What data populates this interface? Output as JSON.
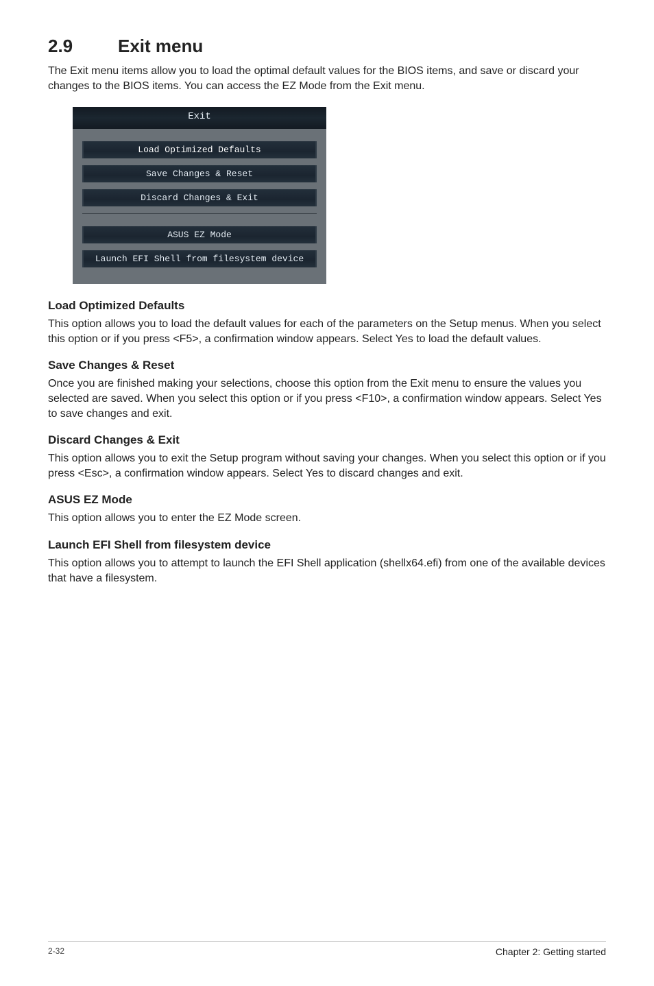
{
  "section": {
    "number": "2.9",
    "title": "Exit menu"
  },
  "intro": "The Exit menu items allow you to load the optimal default values for the BIOS items, and save or discard your changes to the BIOS items. You can access the EZ Mode from the Exit menu.",
  "bios": {
    "header": "Exit",
    "items_top": [
      "Load Optimized Defaults",
      "Save Changes & Reset",
      "Discard Changes & Exit"
    ],
    "items_bottom": [
      "ASUS EZ Mode",
      "Launch EFI Shell from filesystem device"
    ]
  },
  "blocks": [
    {
      "heading": "Load Optimized Defaults",
      "text": "This option allows you to load the default values for each of the parameters on the Setup menus. When you select this option or if you press <F5>, a confirmation window appears. Select Yes to load the default values."
    },
    {
      "heading": "Save Changes & Reset",
      "text": "Once you are finished making your selections, choose this option from the Exit menu to ensure the values you selected are saved. When you select this option or if you press <F10>, a confirmation window appears. Select Yes to save changes and exit."
    },
    {
      "heading": "Discard Changes & Exit",
      "text": "This option allows you to exit the Setup program without saving your changes. When you select this option or if you press <Esc>, a confirmation window appears. Select Yes to discard changes and exit."
    },
    {
      "heading": "ASUS EZ Mode",
      "text": "This option allows you to enter the EZ Mode screen."
    },
    {
      "heading": "Launch EFI Shell from filesystem device",
      "text": "This option allows you to attempt to launch the EFI Shell application (shellx64.efi) from one of the available devices that have a filesystem."
    }
  ],
  "footer": {
    "page": "2-32",
    "chapter": "Chapter 2: Getting started"
  }
}
